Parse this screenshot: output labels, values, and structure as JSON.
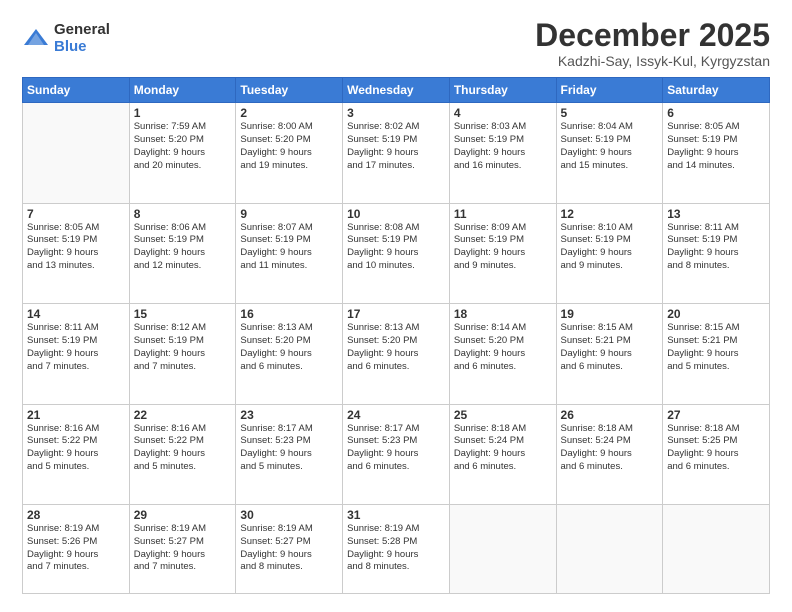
{
  "logo": {
    "general": "General",
    "blue": "Blue"
  },
  "title": "December 2025",
  "location": "Kadzhi-Say, Issyk-Kul, Kyrgyzstan",
  "days_of_week": [
    "Sunday",
    "Monday",
    "Tuesday",
    "Wednesday",
    "Thursday",
    "Friday",
    "Saturday"
  ],
  "weeks": [
    [
      {
        "day": "",
        "info": ""
      },
      {
        "day": "1",
        "info": "Sunrise: 7:59 AM\nSunset: 5:20 PM\nDaylight: 9 hours\nand 20 minutes."
      },
      {
        "day": "2",
        "info": "Sunrise: 8:00 AM\nSunset: 5:20 PM\nDaylight: 9 hours\nand 19 minutes."
      },
      {
        "day": "3",
        "info": "Sunrise: 8:02 AM\nSunset: 5:19 PM\nDaylight: 9 hours\nand 17 minutes."
      },
      {
        "day": "4",
        "info": "Sunrise: 8:03 AM\nSunset: 5:19 PM\nDaylight: 9 hours\nand 16 minutes."
      },
      {
        "day": "5",
        "info": "Sunrise: 8:04 AM\nSunset: 5:19 PM\nDaylight: 9 hours\nand 15 minutes."
      },
      {
        "day": "6",
        "info": "Sunrise: 8:05 AM\nSunset: 5:19 PM\nDaylight: 9 hours\nand 14 minutes."
      }
    ],
    [
      {
        "day": "7",
        "info": "Sunrise: 8:05 AM\nSunset: 5:19 PM\nDaylight: 9 hours\nand 13 minutes."
      },
      {
        "day": "8",
        "info": "Sunrise: 8:06 AM\nSunset: 5:19 PM\nDaylight: 9 hours\nand 12 minutes."
      },
      {
        "day": "9",
        "info": "Sunrise: 8:07 AM\nSunset: 5:19 PM\nDaylight: 9 hours\nand 11 minutes."
      },
      {
        "day": "10",
        "info": "Sunrise: 8:08 AM\nSunset: 5:19 PM\nDaylight: 9 hours\nand 10 minutes."
      },
      {
        "day": "11",
        "info": "Sunrise: 8:09 AM\nSunset: 5:19 PM\nDaylight: 9 hours\nand 9 minutes."
      },
      {
        "day": "12",
        "info": "Sunrise: 8:10 AM\nSunset: 5:19 PM\nDaylight: 9 hours\nand 9 minutes."
      },
      {
        "day": "13",
        "info": "Sunrise: 8:11 AM\nSunset: 5:19 PM\nDaylight: 9 hours\nand 8 minutes."
      }
    ],
    [
      {
        "day": "14",
        "info": "Sunrise: 8:11 AM\nSunset: 5:19 PM\nDaylight: 9 hours\nand 7 minutes."
      },
      {
        "day": "15",
        "info": "Sunrise: 8:12 AM\nSunset: 5:19 PM\nDaylight: 9 hours\nand 7 minutes."
      },
      {
        "day": "16",
        "info": "Sunrise: 8:13 AM\nSunset: 5:20 PM\nDaylight: 9 hours\nand 6 minutes."
      },
      {
        "day": "17",
        "info": "Sunrise: 8:13 AM\nSunset: 5:20 PM\nDaylight: 9 hours\nand 6 minutes."
      },
      {
        "day": "18",
        "info": "Sunrise: 8:14 AM\nSunset: 5:20 PM\nDaylight: 9 hours\nand 6 minutes."
      },
      {
        "day": "19",
        "info": "Sunrise: 8:15 AM\nSunset: 5:21 PM\nDaylight: 9 hours\nand 6 minutes."
      },
      {
        "day": "20",
        "info": "Sunrise: 8:15 AM\nSunset: 5:21 PM\nDaylight: 9 hours\nand 5 minutes."
      }
    ],
    [
      {
        "day": "21",
        "info": "Sunrise: 8:16 AM\nSunset: 5:22 PM\nDaylight: 9 hours\nand 5 minutes."
      },
      {
        "day": "22",
        "info": "Sunrise: 8:16 AM\nSunset: 5:22 PM\nDaylight: 9 hours\nand 5 minutes."
      },
      {
        "day": "23",
        "info": "Sunrise: 8:17 AM\nSunset: 5:23 PM\nDaylight: 9 hours\nand 5 minutes."
      },
      {
        "day": "24",
        "info": "Sunrise: 8:17 AM\nSunset: 5:23 PM\nDaylight: 9 hours\nand 6 minutes."
      },
      {
        "day": "25",
        "info": "Sunrise: 8:18 AM\nSunset: 5:24 PM\nDaylight: 9 hours\nand 6 minutes."
      },
      {
        "day": "26",
        "info": "Sunrise: 8:18 AM\nSunset: 5:24 PM\nDaylight: 9 hours\nand 6 minutes."
      },
      {
        "day": "27",
        "info": "Sunrise: 8:18 AM\nSunset: 5:25 PM\nDaylight: 9 hours\nand 6 minutes."
      }
    ],
    [
      {
        "day": "28",
        "info": "Sunrise: 8:19 AM\nSunset: 5:26 PM\nDaylight: 9 hours\nand 7 minutes."
      },
      {
        "day": "29",
        "info": "Sunrise: 8:19 AM\nSunset: 5:27 PM\nDaylight: 9 hours\nand 7 minutes."
      },
      {
        "day": "30",
        "info": "Sunrise: 8:19 AM\nSunset: 5:27 PM\nDaylight: 9 hours\nand 8 minutes."
      },
      {
        "day": "31",
        "info": "Sunrise: 8:19 AM\nSunset: 5:28 PM\nDaylight: 9 hours\nand 8 minutes."
      },
      {
        "day": "",
        "info": ""
      },
      {
        "day": "",
        "info": ""
      },
      {
        "day": "",
        "info": ""
      }
    ]
  ]
}
